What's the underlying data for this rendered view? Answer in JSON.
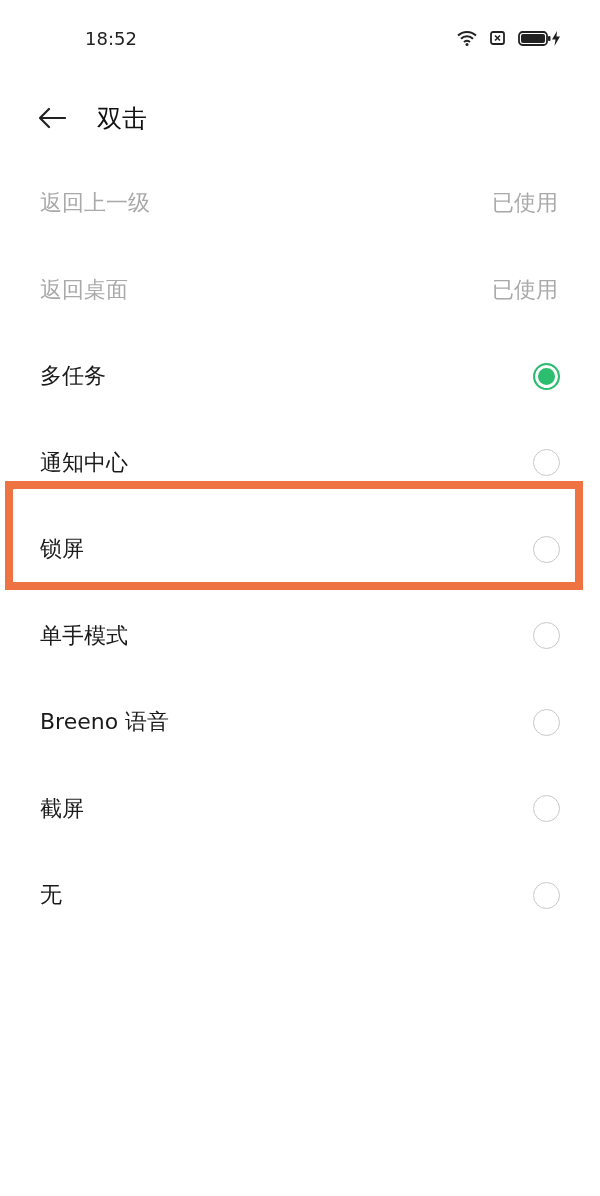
{
  "status_bar": {
    "time": "18:52"
  },
  "header": {
    "title": "双击"
  },
  "options": [
    {
      "kind": "used",
      "label": "返回上一级",
      "status": "已使用",
      "disabled": true,
      "highlighted": false
    },
    {
      "kind": "used",
      "label": "返回桌面",
      "status": "已使用",
      "disabled": true,
      "highlighted": false
    },
    {
      "kind": "radio",
      "label": "多任务",
      "selected": true,
      "disabled": false,
      "highlighted": false
    },
    {
      "kind": "radio",
      "label": "通知中心",
      "selected": false,
      "disabled": false,
      "highlighted": false
    },
    {
      "kind": "radio",
      "label": "锁屏",
      "selected": false,
      "disabled": false,
      "highlighted": true
    },
    {
      "kind": "radio",
      "label": "单手模式",
      "selected": false,
      "disabled": false,
      "highlighted": false
    },
    {
      "kind": "radio",
      "label": "Breeno 语音",
      "selected": false,
      "disabled": false,
      "highlighted": false
    },
    {
      "kind": "radio",
      "label": "截屏",
      "selected": false,
      "disabled": false,
      "highlighted": false
    },
    {
      "kind": "radio",
      "label": "无",
      "selected": false,
      "disabled": false,
      "highlighted": false
    }
  ]
}
